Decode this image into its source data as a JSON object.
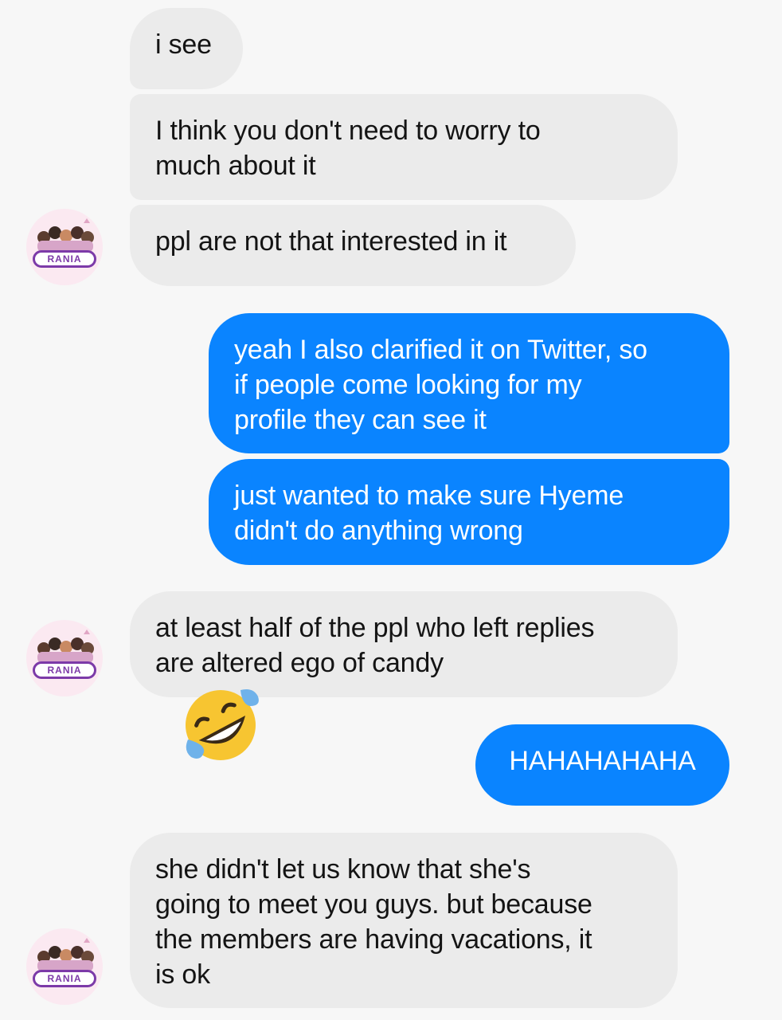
{
  "messages": [
    {
      "sender": "them",
      "text": "i see"
    },
    {
      "sender": "them",
      "text": "I think you don't need to worry to\nmuch about it"
    },
    {
      "sender": "them",
      "text": "ppl are not that interested in it"
    },
    {
      "sender": "me",
      "text": "yeah I also clarified it on Twitter, so\nif people come looking for my\nprofile they can see it"
    },
    {
      "sender": "me",
      "text": "just wanted to make sure Hyeme\ndidn't do anything wrong"
    },
    {
      "sender": "them",
      "text": "at least half of the ppl who left replies\nare altered ego of candy"
    },
    {
      "sender": "them",
      "reaction": "rolling-on-the-floor-laughing-emoji"
    },
    {
      "sender": "me",
      "text": "HAHAHAHAHA"
    },
    {
      "sender": "them",
      "text": "she didn't let us know that she's\ngoing to meet you guys. but because\nthe members are having vacations, it\nis ok"
    }
  ],
  "avatar": {
    "logo_text": "RANIA",
    "background": "#fbe9f1",
    "accent": "#7c3aa8"
  },
  "colors": {
    "incoming_bubble": "#ebebeb",
    "outgoing_bubble": "#0a84ff",
    "background": "#f7f7f7"
  }
}
